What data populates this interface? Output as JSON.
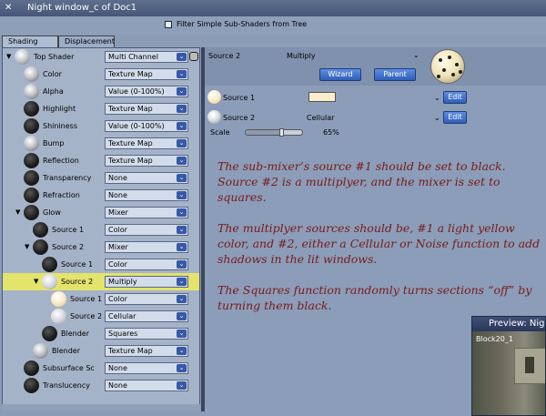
{
  "window": {
    "title": "Night window_c of Doc1",
    "close_glyph": "✕"
  },
  "filter": {
    "label": "Filter Simple Sub-Shaders from Tree",
    "checked": false
  },
  "tabs": [
    {
      "label": "Shading",
      "active": true
    },
    {
      "label": "Displacement",
      "active": false
    }
  ],
  "tree": [
    {
      "label": "Top Shader",
      "value": "Multi Channel",
      "icon": "sphere-textured-icon"
    },
    {
      "label": "Color",
      "value": "Texture Map",
      "icon": "sphere-icon"
    },
    {
      "label": "Alpha",
      "value": "Value (0-100%)",
      "icon": "sphere-icon"
    },
    {
      "label": "Highlight",
      "value": "Texture Map",
      "icon": "black-sphere-icon"
    },
    {
      "label": "Shininess",
      "value": "Value (0-100%)",
      "icon": "black-sphere-icon"
    },
    {
      "label": "Bump",
      "value": "Texture Map",
      "icon": "sphere-icon"
    },
    {
      "label": "Reflection",
      "value": "Texture Map",
      "icon": "black-sphere-icon"
    },
    {
      "label": "Transparency",
      "value": "None",
      "icon": "black-sphere-icon"
    },
    {
      "label": "Refraction",
      "value": "None",
      "icon": "black-sphere-icon"
    },
    {
      "label": "Glow",
      "value": "Mixer",
      "icon": "black-sphere-icon"
    },
    {
      "label": "Source 1",
      "value": "Color",
      "icon": "black-sphere-icon"
    },
    {
      "label": "Source 2",
      "value": "Mixer",
      "icon": "black-sphere-icon"
    },
    {
      "label": "Source 1",
      "value": "Color",
      "icon": "black-sphere-icon"
    },
    {
      "label": "Source 2",
      "value": "Multiply",
      "icon": "cellular-sphere-icon",
      "highlighted": true
    },
    {
      "label": "Source 1",
      "value": "Color",
      "icon": "peach-sphere-icon"
    },
    {
      "label": "Source 2",
      "value": "Cellular",
      "icon": "cellular-sphere-icon"
    },
    {
      "label": "Blender",
      "value": "Squares",
      "icon": "black-sphere-icon"
    },
    {
      "label": "Blender",
      "value": "Texture Map",
      "icon": "sphere-icon"
    },
    {
      "label": "Subsurface Sc",
      "value": "None",
      "icon": "black-sphere-icon"
    },
    {
      "label": "Translucency",
      "value": "None",
      "icon": "black-sphere-icon"
    }
  ],
  "panel": {
    "header_source": "Source 2",
    "header_mode": "Multiply",
    "wizard_label": "Wizard",
    "parent_label": "Parent",
    "source1_label": "Source 1",
    "source1_color": "#fbecce",
    "source2_label": "Source 2",
    "source2_value": "Cellular",
    "edit_label": "Edit",
    "scale_label": "Scale",
    "scale_value": "65%",
    "scale_fraction": 0.65
  },
  "notes": [
    "The sub-mixer’s source #1 should be set to black. Source #2 is a multiplyer, and the mixer is set to squares.",
    "The multiplyer sources should be, #1 a light yellow color, and #2, either a Cellular or Noise function to add shadows in the lit windows.",
    "The Squares function randomly turns sections “off” by turning them black."
  ],
  "preview": {
    "title": "Preview: Nig",
    "label": "Block20_1"
  }
}
